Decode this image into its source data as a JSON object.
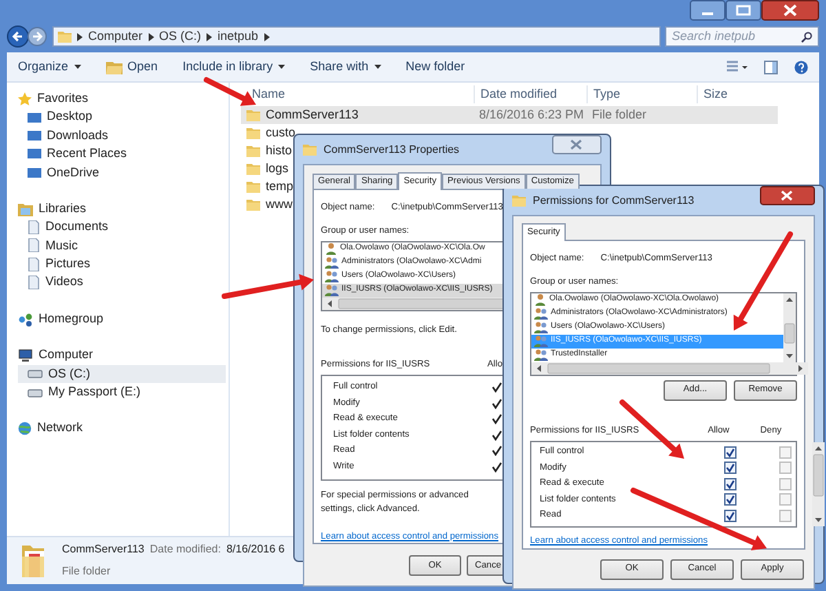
{
  "explorer": {
    "address": {
      "crumbs": [
        "Computer",
        "OS (C:)",
        "inetpub"
      ]
    },
    "search": {
      "placeholder": "Search inetpub"
    },
    "toolbar": [
      {
        "label": "Organize",
        "kind": "dropdown"
      },
      {
        "label": "Open",
        "kind": "open"
      },
      {
        "label": "Include in library",
        "kind": "dropdown"
      },
      {
        "label": "Share with",
        "kind": "dropdown"
      },
      {
        "label": "New folder",
        "kind": "plain"
      }
    ],
    "sidebar": [
      {
        "label": "Favorites",
        "kind": "favorites",
        "items": [
          {
            "label": "Desktop",
            "selected": false
          },
          {
            "label": "Downloads",
            "selected": false
          },
          {
            "label": "Recent Places",
            "selected": false
          },
          {
            "label": "OneDrive",
            "selected": false
          }
        ]
      },
      {
        "label": "Libraries",
        "kind": "libraries",
        "items": [
          {
            "label": "Documents",
            "selected": false
          },
          {
            "label": "Music",
            "selected": false
          },
          {
            "label": "Pictures",
            "selected": false
          },
          {
            "label": "Videos",
            "selected": false
          }
        ]
      },
      {
        "label": "Homegroup",
        "kind": "homegroup"
      },
      {
        "label": "Computer",
        "kind": "computer",
        "items": [
          {
            "label": "OS (C:)",
            "selected": true
          },
          {
            "label": "My Passport (E:)",
            "selected": false
          }
        ]
      },
      {
        "label": "Network",
        "kind": "network"
      }
    ],
    "columns": [
      "Name",
      "Date modified",
      "Type",
      "Size"
    ],
    "rows": [
      {
        "name": "CommServer113",
        "date": "8/16/2016 6:23 PM",
        "type": "File folder",
        "selected": true
      },
      {
        "name": "custo",
        "selected": false
      },
      {
        "name": "histo",
        "selected": false
      },
      {
        "name": "logs",
        "selected": false
      },
      {
        "name": "temp",
        "selected": false
      },
      {
        "name": "www",
        "selected": false
      }
    ],
    "details": {
      "name": "CommServer113",
      "date_label": "Date modified:",
      "date": "8/16/2016 6",
      "type": "File folder"
    }
  },
  "properties": {
    "title": "CommServer113 Properties",
    "tabs": [
      {
        "label": "General",
        "selected": false
      },
      {
        "label": "Sharing",
        "selected": false
      },
      {
        "label": "Security",
        "selected": true
      },
      {
        "label": "Previous Versions",
        "selected": false
      },
      {
        "label": "Customize",
        "selected": false
      }
    ],
    "object_label": "Object name:",
    "object_value": "C:\\inetpub\\CommServer113",
    "group_label": "Group or user names:",
    "users": [
      {
        "name": "Ola.Owolawo (OlaOwolawo-XC\\Ola.Ow",
        "kind": "user",
        "selected": false
      },
      {
        "name": "Administrators (OlaOwolawo-XC\\Admi",
        "kind": "group",
        "selected": false
      },
      {
        "name": "Users (OlaOwolawo-XC\\Users)",
        "kind": "group",
        "selected": false
      },
      {
        "name": "IIS_IUSRS (OlaOwolawo-XC\\IIS_IUSRS)",
        "kind": "group",
        "selected": true
      }
    ],
    "edit_hint": "To change permissions, click Edit.",
    "perm_label": "Permissions for IIS_IUSRS",
    "allow_label": "Allo",
    "permissions": [
      {
        "name": "Full control",
        "allow": true
      },
      {
        "name": "Modify",
        "allow": true
      },
      {
        "name": "Read & execute",
        "allow": true
      },
      {
        "name": "List folder contents",
        "allow": true
      },
      {
        "name": "Read",
        "allow": true
      },
      {
        "name": "Write",
        "allow": true
      }
    ],
    "advanced_note": "For special permissions or advanced settings, click Advanced.",
    "link": "Learn about access control and permissions",
    "buttons": [
      "OK",
      "Cance"
    ]
  },
  "permissions": {
    "title": "Permissions for CommServer113",
    "tabs": [
      {
        "label": "Security",
        "selected": true
      }
    ],
    "object_label": "Object name:",
    "object_value": "C:\\inetpub\\CommServer113",
    "group_label": "Group or user names:",
    "users": [
      {
        "name": "Ola.Owolawo (OlaOwolawo-XC\\Ola.Owolawo)",
        "kind": "user",
        "selected": false
      },
      {
        "name": "Administrators (OlaOwolawo-XC\\Administrators)",
        "kind": "group",
        "selected": false
      },
      {
        "name": "Users (OlaOwolawo-XC\\Users)",
        "kind": "group",
        "selected": false
      },
      {
        "name": "IIS_IUSRS (OlaOwolawo-XC\\IIS_IUSRS)",
        "kind": "group",
        "selected": true
      },
      {
        "name": "TrustedInstaller",
        "kind": "group",
        "selected": false
      }
    ],
    "list_buttons": [
      "Add...",
      "Remove"
    ],
    "perm_label": "Permissions for IIS_IUSRS",
    "allow_label": "Allow",
    "deny_label": "Deny",
    "permissions": [
      {
        "name": "Full control",
        "allow": true,
        "deny": false
      },
      {
        "name": "Modify",
        "allow": true,
        "deny": false
      },
      {
        "name": "Read & execute",
        "allow": true,
        "deny": false
      },
      {
        "name": "List folder contents",
        "allow": true,
        "deny": false
      },
      {
        "name": "Read",
        "allow": true,
        "deny": false
      }
    ],
    "link": "Learn about access control and permissions",
    "buttons": [
      "OK",
      "Cancel",
      "Apply"
    ]
  }
}
